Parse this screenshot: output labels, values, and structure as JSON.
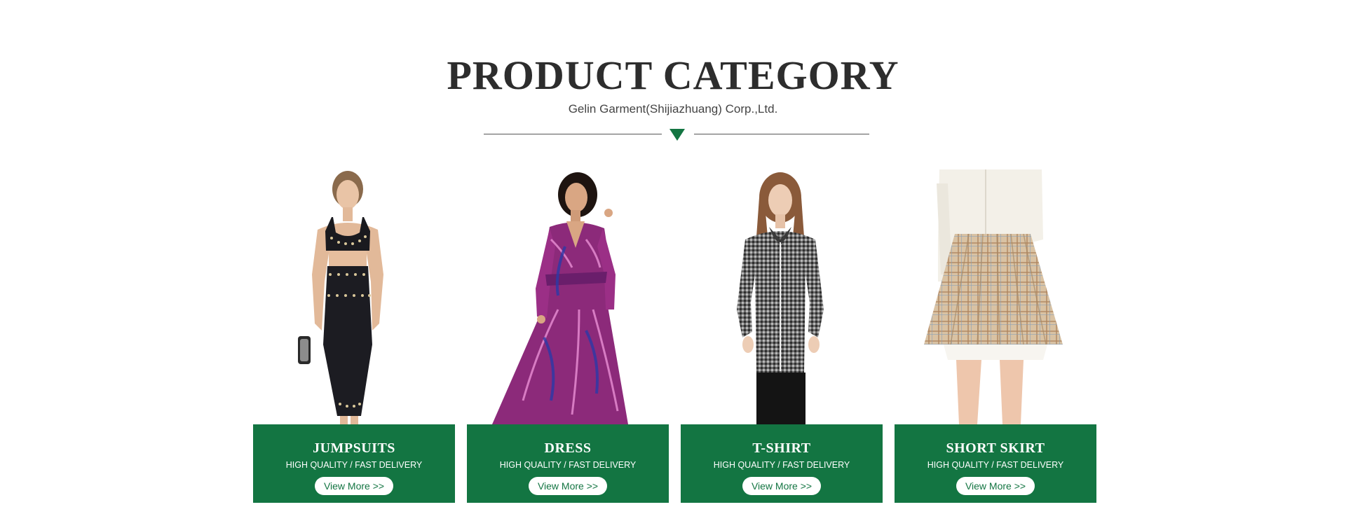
{
  "header": {
    "title": "PRODUCT CATEGORY",
    "subtitle": "Gelin Garment(Shijiazhuang) Corp.,Ltd."
  },
  "categories": [
    {
      "name": "JUMPSUITS",
      "tagline": "HIGH QUALITY / FAST DELIVERY",
      "button_label": "View More >>"
    },
    {
      "name": "DRESS",
      "tagline": "HIGH QUALITY / FAST DELIVERY",
      "button_label": "View More >>"
    },
    {
      "name": "T-SHIRT",
      "tagline": "HIGH QUALITY / FAST DELIVERY",
      "button_label": "View More >>"
    },
    {
      "name": "SHORT SKIRT",
      "tagline": "HIGH QUALITY / FAST DELIVERY",
      "button_label": "View More >>"
    }
  ],
  "colors": {
    "accent": "#137542",
    "title": "#2d2d2d",
    "subtitle": "#444444",
    "background": "#ffffff"
  }
}
